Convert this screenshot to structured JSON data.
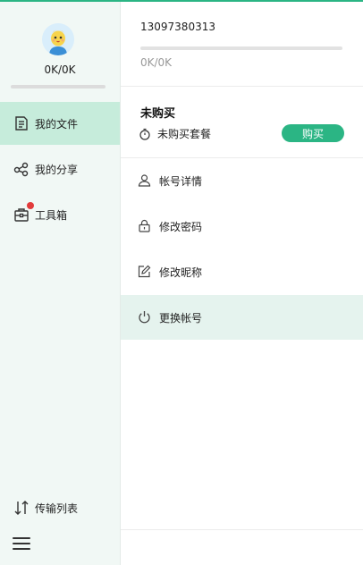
{
  "sidebar": {
    "quota_text": "0K/0K",
    "nav": [
      {
        "label": "我的文件",
        "icon": "file-doc-icon",
        "active": true
      },
      {
        "label": "我的分享",
        "icon": "share-icon",
        "active": false
      },
      {
        "label": "工具箱",
        "icon": "toolbox-icon",
        "active": false
      }
    ],
    "transfer_label": "传输列表"
  },
  "account": {
    "phone": "13097380313",
    "quota": "0K/0K",
    "plan_title": "未购买",
    "plan_status": "未购买套餐",
    "buy_label": "购买",
    "menu": [
      {
        "label": "帐号详情",
        "icon": "user-icon"
      },
      {
        "label": "修改密码",
        "icon": "lock-icon"
      },
      {
        "label": "修改昵称",
        "icon": "edit-icon"
      },
      {
        "label": "更换帐号",
        "icon": "power-icon"
      }
    ]
  },
  "colors": {
    "accent": "#2bb584",
    "sidebar_bg": "#f1f8f5",
    "active_nav": "#c6ecdb",
    "badge": "#e23b3b"
  }
}
